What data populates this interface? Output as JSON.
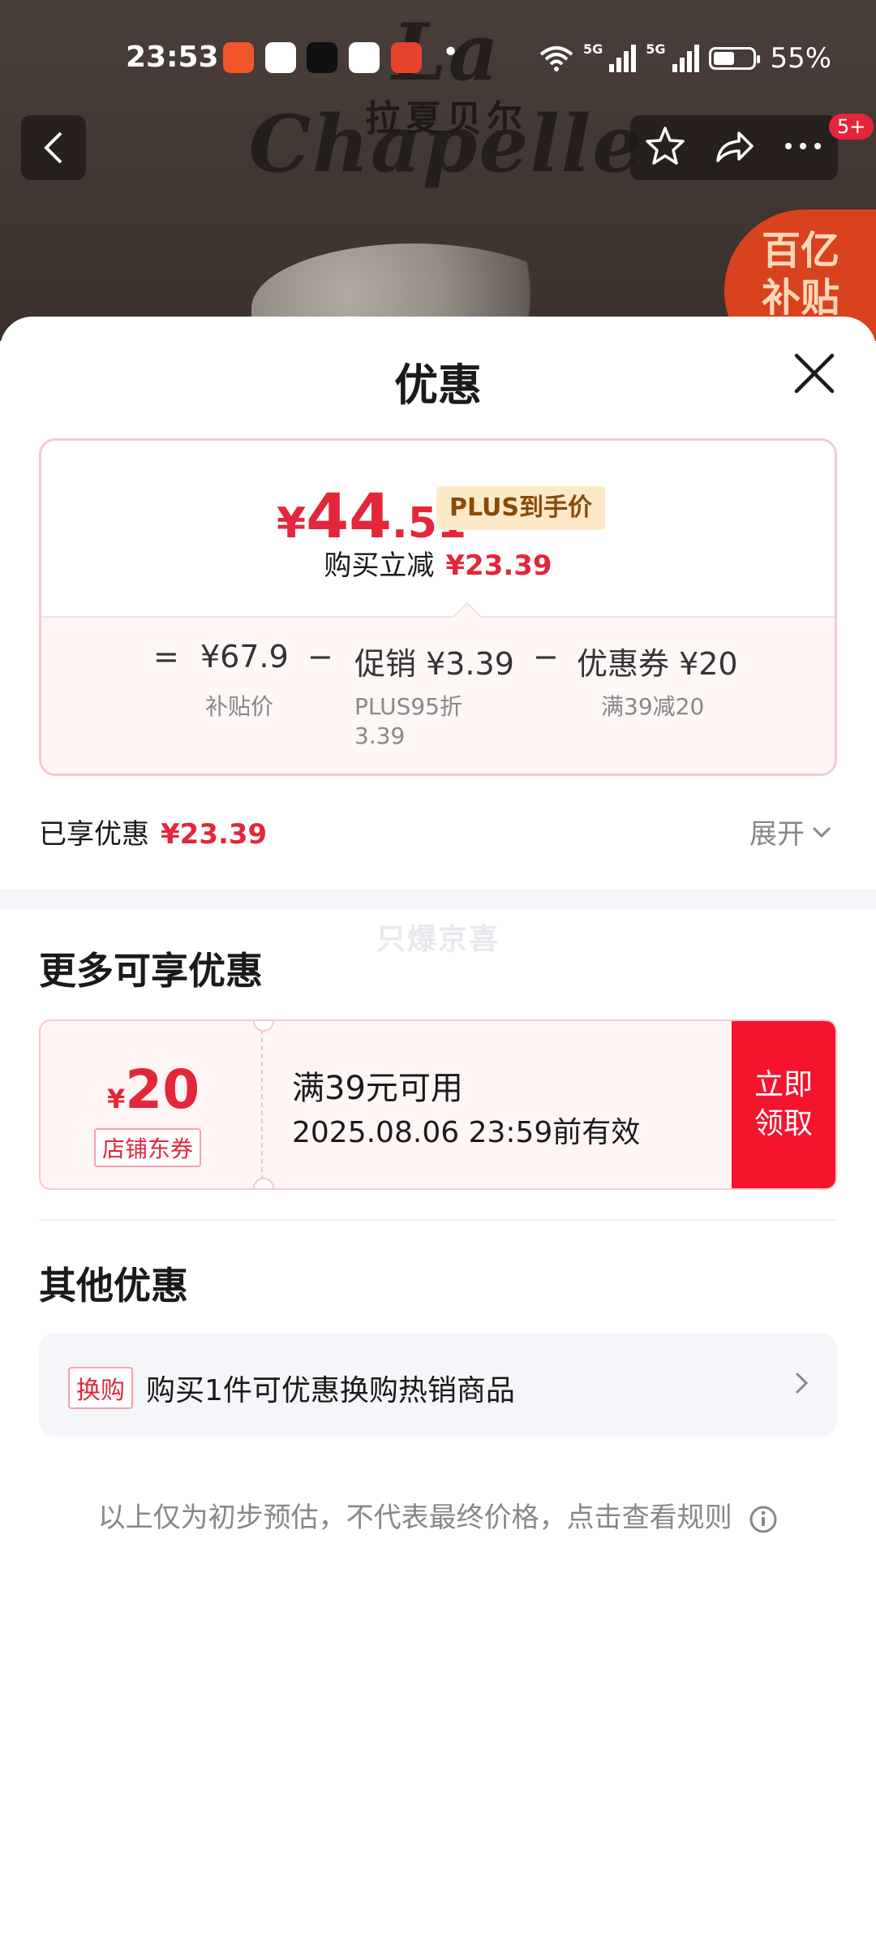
{
  "status_bar": {
    "time": "23:53",
    "network_label": "5G",
    "battery": "55%",
    "battery_level": 0.55
  },
  "background": {
    "brand_name": "La Chapelle",
    "brand_name_cn": "拉夏贝尔",
    "badge_count": "5+",
    "promo_badge_line1": "百亿",
    "promo_badge_line2": "补贴"
  },
  "sheet": {
    "title": "优惠",
    "price_card": {
      "currency": "¥",
      "price_int": "44",
      "price_dec": ".51",
      "plus_tag": "PLUS到手价",
      "reduce_label": "购买立减",
      "reduce_amount": "¥23.39",
      "calc": [
        {
          "op": "=",
          "value": "¥67.9",
          "label": "补贴价"
        },
        {
          "op": "−",
          "value": "促销 ¥3.39",
          "label": "PLUS95折\n3.39"
        },
        {
          "op": "−",
          "value": "优惠券 ¥20",
          "label": "满39减20"
        }
      ]
    },
    "enjoyed_label": "已享优惠",
    "enjoyed_amount": "¥23.39",
    "expand_label": "展开",
    "watermark": "只爆京喜",
    "more_title": "更多可享优惠",
    "coupon": {
      "currency": "¥",
      "amount": "20",
      "type": "店铺东券",
      "condition": "满39元可用",
      "valid": "2025.08.06 23:59前有效",
      "claim_line1": "立即",
      "claim_line2": "领取"
    },
    "other_title": "其他优惠",
    "other_item": {
      "tag": "换购",
      "text": "购买1件可优惠换购热销商品"
    },
    "disclaimer": "以上仅为初步预估，不代表最终价格，点击查看规则"
  },
  "colors": {
    "accent_red": "#e4263a",
    "claim_red": "#f6132e",
    "plus_gold": "#fde9c8"
  }
}
